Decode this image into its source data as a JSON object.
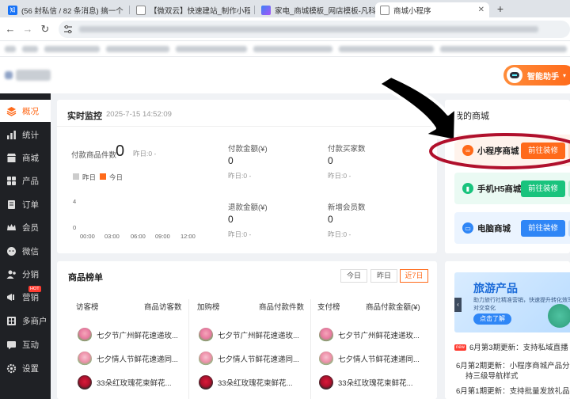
{
  "browser": {
    "tabs": [
      {
        "label": "(56 封私信 / 82 条消息) 搞一个",
        "favicon": "知",
        "color": "#1772f6"
      },
      {
        "label": "【微双云】快速建站_制作小程",
        "favicon": "",
        "color": "#888888"
      },
      {
        "label": "家电_商城模板_网店模板-凡科",
        "favicon": "",
        "color": "#6a5acd"
      },
      {
        "label": "商城小程序",
        "favicon": "",
        "color": "#888888"
      }
    ],
    "new_tab": "+"
  },
  "header": {
    "ai_button": "智能助手"
  },
  "sidebar": {
    "items": [
      {
        "label": "概况",
        "icon": "overview-icon"
      },
      {
        "label": "统计",
        "icon": "statistics-icon"
      },
      {
        "label": "商城",
        "icon": "store-icon"
      },
      {
        "label": "产品",
        "icon": "product-icon"
      },
      {
        "label": "订单",
        "icon": "order-icon"
      },
      {
        "label": "会员",
        "icon": "member-icon"
      },
      {
        "label": "微信",
        "icon": "wechat-icon"
      },
      {
        "label": "分销",
        "icon": "distribution-icon"
      },
      {
        "label": "营销",
        "icon": "marketing-icon",
        "badge": "HOT"
      },
      {
        "label": "多商户",
        "icon": "merchant-icon"
      },
      {
        "label": "互动",
        "icon": "interaction-icon"
      },
      {
        "label": "设置",
        "icon": "settings-icon"
      }
    ]
  },
  "monitor": {
    "title": "实时监控",
    "time": "2025-7-15 14:52:09",
    "paid_products_label": "付款商品件数",
    "paid_products_value": "0",
    "paid_products_yesterday": "昨日:0  -",
    "legend_yesterday": "昨日",
    "legend_today": "今日",
    "y_ticks": [
      "4",
      "0"
    ],
    "x_ticks": [
      "00:00",
      "03:00",
      "06:00",
      "09:00",
      "12:00"
    ],
    "stats": [
      {
        "label": "付款金额(¥)",
        "value": "0",
        "sub": "昨日:0  -"
      },
      {
        "label": "付款买家数",
        "value": "0",
        "sub": "昨日:0  -"
      },
      {
        "label": "退款金额(¥)",
        "value": "0",
        "sub": "昨日:0  -"
      },
      {
        "label": "新增会员数",
        "value": "0",
        "sub": "昨日:0  -"
      }
    ],
    "colors": {
      "yesterday": "#cccccc",
      "today": "#ff6a1a"
    }
  },
  "my_shop": {
    "title": "我的商城",
    "shops": [
      {
        "name": "小程序商城",
        "button": "前往装修",
        "btn_color": "#ff6a1a",
        "bg": "#fff3ec",
        "icon_color": "#ff6a1a"
      },
      {
        "name": "手机H5商城",
        "button": "前往装修",
        "btn_color": "#19c37d",
        "bg": "#eafaf3",
        "icon_color": "#19c37d"
      },
      {
        "name": "电脑商城",
        "button": "前往装修",
        "btn_color": "#2f86f6",
        "bg": "#ebf4ff",
        "icon_color": "#2f86f6"
      }
    ]
  },
  "rank": {
    "title": "商品榜单",
    "tabs": [
      "今日",
      "昨日",
      "近7日"
    ],
    "columns": [
      {
        "head_left": "访客榜",
        "head_right": "商品访客数"
      },
      {
        "head_left": "加购榜",
        "head_right": "商品付款件数"
      },
      {
        "head_left": "支付榜",
        "head_right": "商品付款金额(¥)"
      }
    ],
    "rows": [
      "七夕节广州鲜花速递玫...",
      "七夕情人节鲜花速递同...",
      "33朵红玫瑰花束鲜花..."
    ]
  },
  "promo": {
    "title": "旅游产品",
    "subtitle": "助力旅行社精准营销，快速提升转化效率",
    "subtitle2": "对交变化",
    "button": "点击了解"
  },
  "news": {
    "new_badge": "new",
    "items": [
      "6月第3期更新：支持私域直播",
      "6月第2期更新：小程序商城产品分",
      "持三级导航样式",
      "6月第1期更新：支持批量发放礼品"
    ]
  }
}
